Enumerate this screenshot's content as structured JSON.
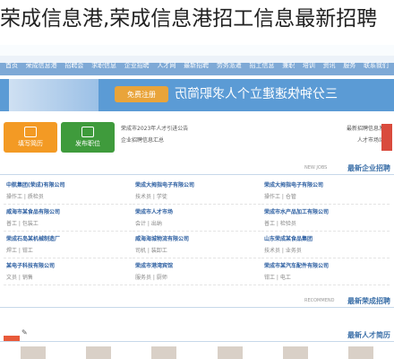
{
  "page_title": "荣成信息港,荣成信息港招工信息最新招聘",
  "nav": {
    "items": [
      "首页",
      "荣成信息港",
      "招聘会",
      "求职信息",
      "企业招聘",
      "人才网",
      "最新招聘",
      "劳务派遣",
      "招工信息",
      "兼职",
      "培训",
      "资讯",
      "服务",
      "联系我们"
    ]
  },
  "banner": {
    "button_label": "免费注册",
    "slogan": "三分钟快速建立个人求职简历"
  },
  "quick": {
    "post_job": "发布职位",
    "resume": "填写简历"
  },
  "notices": [
    {
      "left": "荣成市2023年人才引进公告",
      "right": "最新招聘信息发布"
    },
    {
      "left": "企业招聘信息汇总",
      "right": "人才市场动态"
    }
  ],
  "sections": {
    "featured": "最新企业招聘",
    "featured_sub": "NEW JOBS",
    "recommended": "最新荣成招聘",
    "recommended_sub": "RECOMMEND",
    "talent": "最新人才简历"
  },
  "jobs": {
    "col1": [
      {
        "name": "中航集团(荣成)有限公司",
        "pos": "操作工 | 质检员"
      },
      {
        "name": "威海市某食品有限公司",
        "pos": "普工 | 包装工"
      },
      {
        "name": "荣成石岛某机械制造厂",
        "pos": "焊工 | 钳工"
      },
      {
        "name": "某电子科技有限公司",
        "pos": "文员 | 销售"
      }
    ],
    "col2": [
      {
        "name": "荣成大拇指电子有限公司",
        "pos": "技术员 | 学徒"
      },
      {
        "name": "荣成市人才市场",
        "pos": "会计 | 出纳"
      },
      {
        "name": "威海海城物流有限公司",
        "pos": "司机 | 装卸工"
      },
      {
        "name": "荣成市港湾宾馆",
        "pos": "服务员 | 厨师"
      }
    ],
    "col3": [
      {
        "name": "荣成大拇指电子有限公司",
        "pos": "操作工 | 仓管"
      },
      {
        "name": "荣成市水产品加工有限公司",
        "pos": "普工 | 检验员"
      },
      {
        "name": "山东荣成某食品集团",
        "pos": "技术员 | 业务员"
      },
      {
        "name": "荣成市某汽车配件有限公司",
        "pos": "钳工 | 电工"
      }
    ]
  }
}
